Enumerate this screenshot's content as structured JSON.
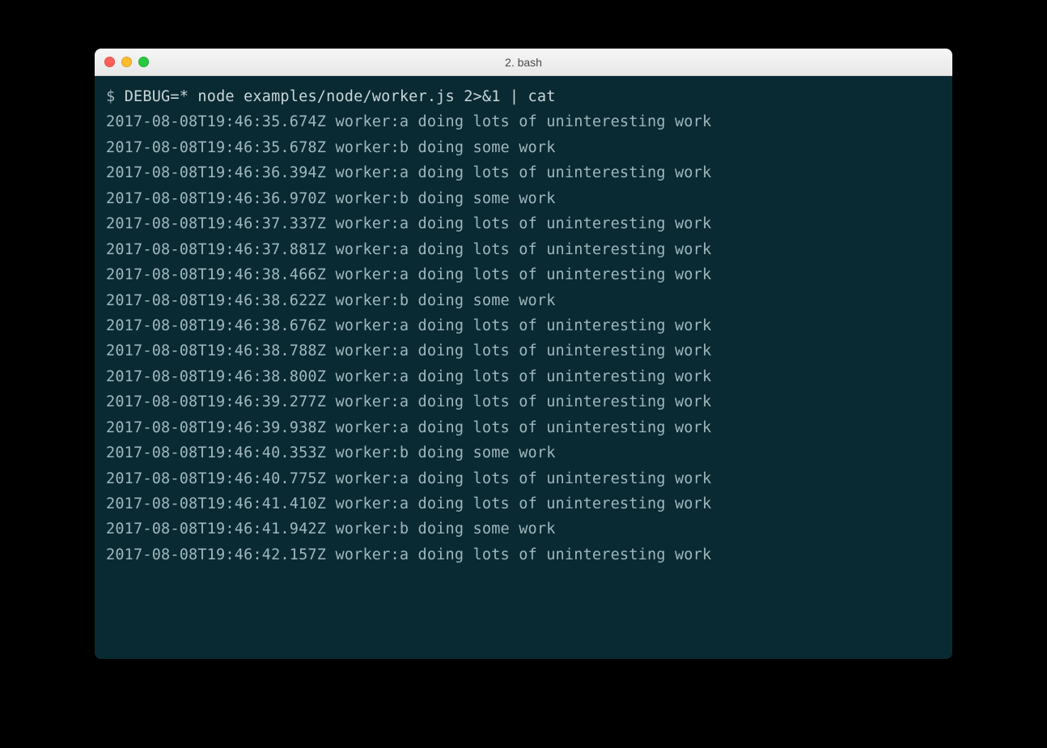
{
  "window": {
    "title": "2. bash"
  },
  "terminal": {
    "prompt": "$ ",
    "command": "DEBUG=* node examples/node/worker.js 2>&1 | cat",
    "lines": [
      "2017-08-08T19:46:35.674Z worker:a doing lots of uninteresting work",
      "2017-08-08T19:46:35.678Z worker:b doing some work",
      "2017-08-08T19:46:36.394Z worker:a doing lots of uninteresting work",
      "2017-08-08T19:46:36.970Z worker:b doing some work",
      "2017-08-08T19:46:37.337Z worker:a doing lots of uninteresting work",
      "2017-08-08T19:46:37.881Z worker:a doing lots of uninteresting work",
      "2017-08-08T19:46:38.466Z worker:a doing lots of uninteresting work",
      "2017-08-08T19:46:38.622Z worker:b doing some work",
      "2017-08-08T19:46:38.676Z worker:a doing lots of uninteresting work",
      "2017-08-08T19:46:38.788Z worker:a doing lots of uninteresting work",
      "2017-08-08T19:46:38.800Z worker:a doing lots of uninteresting work",
      "2017-08-08T19:46:39.277Z worker:a doing lots of uninteresting work",
      "2017-08-08T19:46:39.938Z worker:a doing lots of uninteresting work",
      "2017-08-08T19:46:40.353Z worker:b doing some work",
      "2017-08-08T19:46:40.775Z worker:a doing lots of uninteresting work",
      "2017-08-08T19:46:41.410Z worker:a doing lots of uninteresting work",
      "2017-08-08T19:46:41.942Z worker:b doing some work",
      "2017-08-08T19:46:42.157Z worker:a doing lots of uninteresting work"
    ]
  }
}
